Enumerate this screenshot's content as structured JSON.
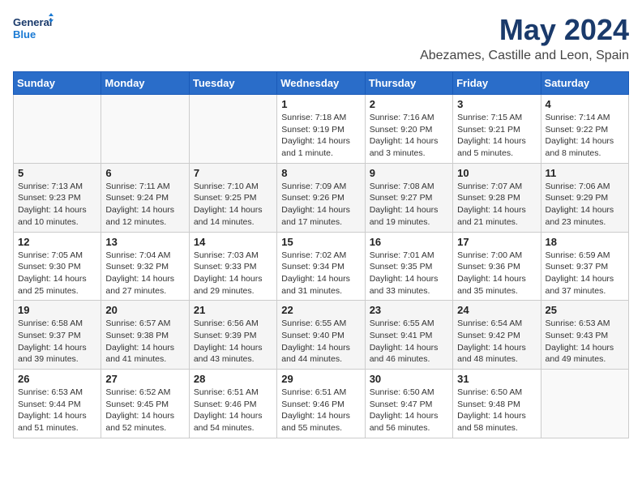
{
  "logo": {
    "line1": "General",
    "line2": "Blue"
  },
  "title": "May 2024",
  "subtitle": "Abezames, Castille and Leon, Spain",
  "days_header": [
    "Sunday",
    "Monday",
    "Tuesday",
    "Wednesday",
    "Thursday",
    "Friday",
    "Saturday"
  ],
  "weeks": [
    [
      {
        "day": "",
        "info": ""
      },
      {
        "day": "",
        "info": ""
      },
      {
        "day": "",
        "info": ""
      },
      {
        "day": "1",
        "info": "Sunrise: 7:18 AM\nSunset: 9:19 PM\nDaylight: 14 hours\nand 1 minute."
      },
      {
        "day": "2",
        "info": "Sunrise: 7:16 AM\nSunset: 9:20 PM\nDaylight: 14 hours\nand 3 minutes."
      },
      {
        "day": "3",
        "info": "Sunrise: 7:15 AM\nSunset: 9:21 PM\nDaylight: 14 hours\nand 5 minutes."
      },
      {
        "day": "4",
        "info": "Sunrise: 7:14 AM\nSunset: 9:22 PM\nDaylight: 14 hours\nand 8 minutes."
      }
    ],
    [
      {
        "day": "5",
        "info": "Sunrise: 7:13 AM\nSunset: 9:23 PM\nDaylight: 14 hours\nand 10 minutes."
      },
      {
        "day": "6",
        "info": "Sunrise: 7:11 AM\nSunset: 9:24 PM\nDaylight: 14 hours\nand 12 minutes."
      },
      {
        "day": "7",
        "info": "Sunrise: 7:10 AM\nSunset: 9:25 PM\nDaylight: 14 hours\nand 14 minutes."
      },
      {
        "day": "8",
        "info": "Sunrise: 7:09 AM\nSunset: 9:26 PM\nDaylight: 14 hours\nand 17 minutes."
      },
      {
        "day": "9",
        "info": "Sunrise: 7:08 AM\nSunset: 9:27 PM\nDaylight: 14 hours\nand 19 minutes."
      },
      {
        "day": "10",
        "info": "Sunrise: 7:07 AM\nSunset: 9:28 PM\nDaylight: 14 hours\nand 21 minutes."
      },
      {
        "day": "11",
        "info": "Sunrise: 7:06 AM\nSunset: 9:29 PM\nDaylight: 14 hours\nand 23 minutes."
      }
    ],
    [
      {
        "day": "12",
        "info": "Sunrise: 7:05 AM\nSunset: 9:30 PM\nDaylight: 14 hours\nand 25 minutes."
      },
      {
        "day": "13",
        "info": "Sunrise: 7:04 AM\nSunset: 9:32 PM\nDaylight: 14 hours\nand 27 minutes."
      },
      {
        "day": "14",
        "info": "Sunrise: 7:03 AM\nSunset: 9:33 PM\nDaylight: 14 hours\nand 29 minutes."
      },
      {
        "day": "15",
        "info": "Sunrise: 7:02 AM\nSunset: 9:34 PM\nDaylight: 14 hours\nand 31 minutes."
      },
      {
        "day": "16",
        "info": "Sunrise: 7:01 AM\nSunset: 9:35 PM\nDaylight: 14 hours\nand 33 minutes."
      },
      {
        "day": "17",
        "info": "Sunrise: 7:00 AM\nSunset: 9:36 PM\nDaylight: 14 hours\nand 35 minutes."
      },
      {
        "day": "18",
        "info": "Sunrise: 6:59 AM\nSunset: 9:37 PM\nDaylight: 14 hours\nand 37 minutes."
      }
    ],
    [
      {
        "day": "19",
        "info": "Sunrise: 6:58 AM\nSunset: 9:37 PM\nDaylight: 14 hours\nand 39 minutes."
      },
      {
        "day": "20",
        "info": "Sunrise: 6:57 AM\nSunset: 9:38 PM\nDaylight: 14 hours\nand 41 minutes."
      },
      {
        "day": "21",
        "info": "Sunrise: 6:56 AM\nSunset: 9:39 PM\nDaylight: 14 hours\nand 43 minutes."
      },
      {
        "day": "22",
        "info": "Sunrise: 6:55 AM\nSunset: 9:40 PM\nDaylight: 14 hours\nand 44 minutes."
      },
      {
        "day": "23",
        "info": "Sunrise: 6:55 AM\nSunset: 9:41 PM\nDaylight: 14 hours\nand 46 minutes."
      },
      {
        "day": "24",
        "info": "Sunrise: 6:54 AM\nSunset: 9:42 PM\nDaylight: 14 hours\nand 48 minutes."
      },
      {
        "day": "25",
        "info": "Sunrise: 6:53 AM\nSunset: 9:43 PM\nDaylight: 14 hours\nand 49 minutes."
      }
    ],
    [
      {
        "day": "26",
        "info": "Sunrise: 6:53 AM\nSunset: 9:44 PM\nDaylight: 14 hours\nand 51 minutes."
      },
      {
        "day": "27",
        "info": "Sunrise: 6:52 AM\nSunset: 9:45 PM\nDaylight: 14 hours\nand 52 minutes."
      },
      {
        "day": "28",
        "info": "Sunrise: 6:51 AM\nSunset: 9:46 PM\nDaylight: 14 hours\nand 54 minutes."
      },
      {
        "day": "29",
        "info": "Sunrise: 6:51 AM\nSunset: 9:46 PM\nDaylight: 14 hours\nand 55 minutes."
      },
      {
        "day": "30",
        "info": "Sunrise: 6:50 AM\nSunset: 9:47 PM\nDaylight: 14 hours\nand 56 minutes."
      },
      {
        "day": "31",
        "info": "Sunrise: 6:50 AM\nSunset: 9:48 PM\nDaylight: 14 hours\nand 58 minutes."
      },
      {
        "day": "",
        "info": ""
      }
    ]
  ]
}
